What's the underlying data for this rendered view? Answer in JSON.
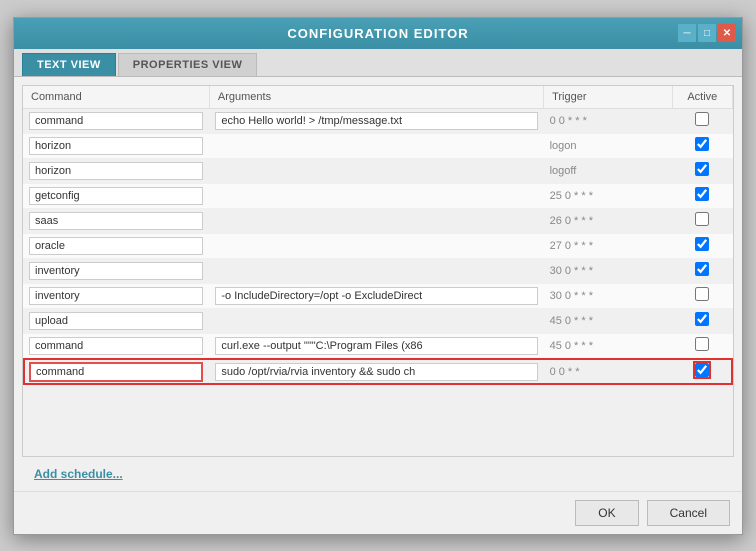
{
  "dialog": {
    "title": "CONFIGURATION EDITOR",
    "tabs": [
      {
        "id": "text-view",
        "label": "TEXT VIEW",
        "active": true
      },
      {
        "id": "properties-view",
        "label": "PROPERTIES VIEW",
        "active": false
      }
    ],
    "controls": {
      "minimize": "─",
      "restore": "□",
      "close": "✕"
    }
  },
  "table": {
    "headers": [
      "Command",
      "Arguments",
      "Trigger",
      "Active"
    ],
    "rows": [
      {
        "command": "command",
        "arguments": "echo Hello world! > /tmp/message.txt",
        "trigger": "0 0 * * *",
        "active": false,
        "highlighted": false
      },
      {
        "command": "horizon",
        "arguments": "",
        "trigger": "logon",
        "active": true,
        "highlighted": false
      },
      {
        "command": "horizon",
        "arguments": "",
        "trigger": "logoff",
        "active": true,
        "highlighted": false
      },
      {
        "command": "getconfig",
        "arguments": "",
        "trigger": "25 0 * * *",
        "active": true,
        "highlighted": false
      },
      {
        "command": "saas",
        "arguments": "",
        "trigger": "26 0 * * *",
        "active": false,
        "highlighted": false
      },
      {
        "command": "oracle",
        "arguments": "",
        "trigger": "27 0 * * *",
        "active": true,
        "highlighted": false
      },
      {
        "command": "inventory",
        "arguments": "",
        "trigger": "30 0 * * *",
        "active": true,
        "highlighted": false
      },
      {
        "command": "inventory",
        "arguments": "-o IncludeDirectory=/opt -o ExcludeDirect",
        "trigger": "30 0 * * *",
        "active": false,
        "highlighted": false
      },
      {
        "command": "upload",
        "arguments": "",
        "trigger": "45 0 * * *",
        "active": true,
        "highlighted": false
      },
      {
        "command": "command",
        "arguments": "curl.exe --output \"\"\"C:\\Program Files (x86",
        "trigger": "45 0 * * *",
        "active": false,
        "highlighted": false
      },
      {
        "command": "command",
        "arguments": "sudo /opt/rvia/rvia inventory && sudo ch",
        "trigger": "0 0 * *",
        "active": true,
        "highlighted": true
      }
    ]
  },
  "add_schedule_label": "Add schedule...",
  "footer": {
    "ok_label": "OK",
    "cancel_label": "Cancel"
  }
}
